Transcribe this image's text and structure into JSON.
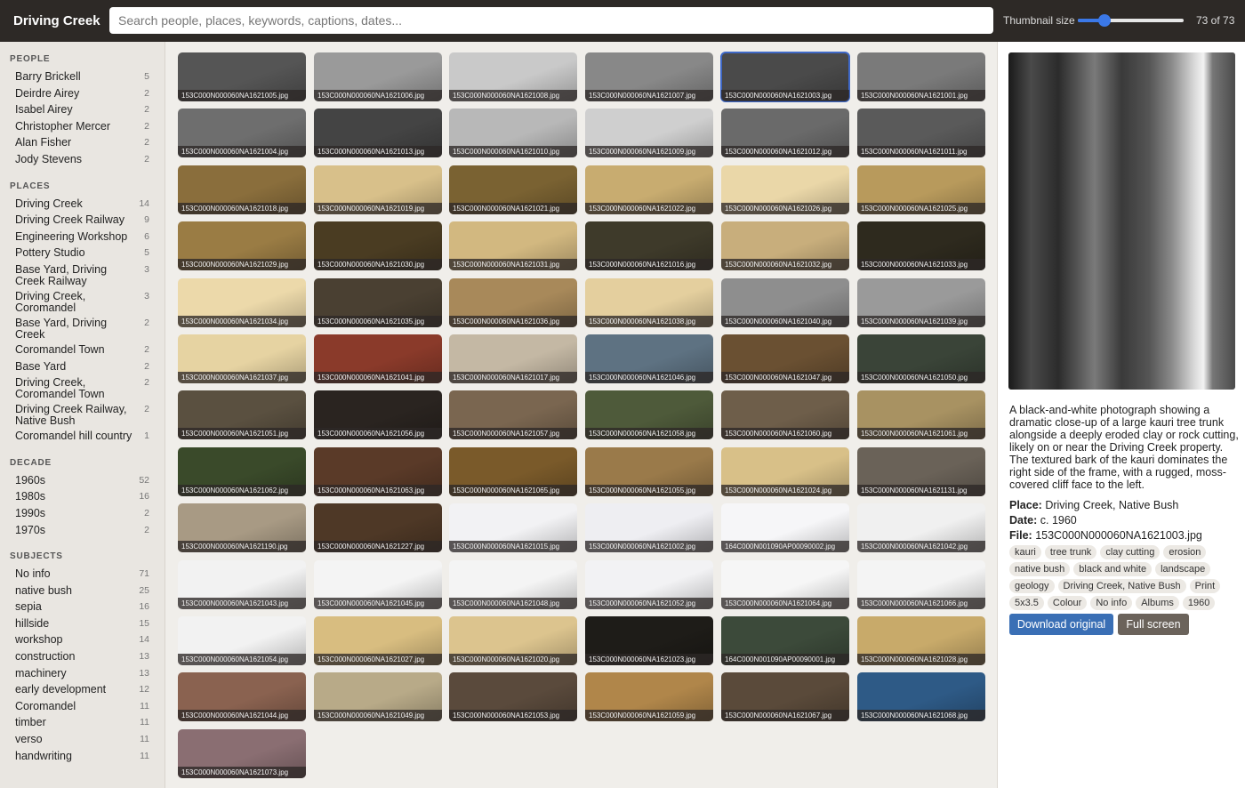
{
  "header": {
    "title": "Driving Creek",
    "search_placeholder": "Search people, places, keywords, captions, dates...",
    "thumbnail_size_label": "Thumbnail size",
    "thumbnail_size_value": 0.25,
    "count": "73 of 73"
  },
  "sidebar": {
    "people": {
      "title": "PEOPLE",
      "items": [
        {
          "label": "Barry Brickell",
          "count": "5"
        },
        {
          "label": "Deirdre Airey",
          "count": "2"
        },
        {
          "label": "Isabel Airey",
          "count": "2"
        },
        {
          "label": "Christopher Mercer",
          "count": "2"
        },
        {
          "label": "Alan Fisher",
          "count": "2"
        },
        {
          "label": "Jody Stevens",
          "count": "2"
        }
      ]
    },
    "places": {
      "title": "PLACES",
      "items": [
        {
          "label": "Driving Creek",
          "count": "14"
        },
        {
          "label": "Driving Creek Railway",
          "count": "9"
        },
        {
          "label": "Engineering Workshop",
          "count": "6"
        },
        {
          "label": "Pottery Studio",
          "count": "5"
        },
        {
          "label": "Base Yard, Driving Creek Railway",
          "count": "3"
        },
        {
          "label": "Driving Creek, Coromandel",
          "count": "3"
        },
        {
          "label": "Base Yard, Driving Creek",
          "count": "2"
        },
        {
          "label": "Coromandel Town",
          "count": "2"
        },
        {
          "label": "Base Yard",
          "count": "2"
        },
        {
          "label": "Driving Creek, Coromandel Town",
          "count": "2"
        },
        {
          "label": "Driving Creek Railway, Native Bush",
          "count": "2"
        },
        {
          "label": "Coromandel hill country",
          "count": "1"
        }
      ]
    },
    "decade": {
      "title": "DECADE",
      "items": [
        {
          "label": "1960s",
          "count": "52"
        },
        {
          "label": "1980s",
          "count": "16"
        },
        {
          "label": "1990s",
          "count": "2"
        },
        {
          "label": "1970s",
          "count": "2"
        }
      ]
    },
    "subjects": {
      "title": "SUBJECTS",
      "items": [
        {
          "label": "No info",
          "count": "71"
        },
        {
          "label": "native bush",
          "count": "25"
        },
        {
          "label": "sepia",
          "count": "16"
        },
        {
          "label": "hillside",
          "count": "15"
        },
        {
          "label": "workshop",
          "count": "14"
        },
        {
          "label": "construction",
          "count": "13"
        },
        {
          "label": "machinery",
          "count": "13"
        },
        {
          "label": "early development",
          "count": "12"
        },
        {
          "label": "Coromandel",
          "count": "11"
        },
        {
          "label": "timber",
          "count": "11"
        },
        {
          "label": "verso",
          "count": "11"
        },
        {
          "label": "handwriting",
          "count": "11"
        }
      ]
    }
  },
  "grid": {
    "items": [
      {
        "file": "153C000N000060NA1621005.jpg",
        "tone": "#555"
      },
      {
        "file": "153C000N000060NA1621006.jpg",
        "tone": "#9a9a9a"
      },
      {
        "file": "153C000N000060NA1621008.jpg",
        "tone": "#c9c9c9"
      },
      {
        "file": "153C000N000060NA1621007.jpg",
        "tone": "#888"
      },
      {
        "file": "153C000N000060NA1621003.jpg",
        "tone": "#4a4a4a",
        "selected": true
      },
      {
        "file": "153C000N000060NA1621001.jpg",
        "tone": "#7a7a7a"
      },
      {
        "file": "153C000N000060NA1621004.jpg",
        "tone": "#6e6e6e"
      },
      {
        "file": "153C000N000060NA1621013.jpg",
        "tone": "#444"
      },
      {
        "file": "153C000N000060NA1621010.jpg",
        "tone": "#b8b8b8"
      },
      {
        "file": "153C000N000060NA1621009.jpg",
        "tone": "#cfcfcf"
      },
      {
        "file": "153C000N000060NA1621012.jpg",
        "tone": "#6a6a6a"
      },
      {
        "file": "153C000N000060NA1621011.jpg",
        "tone": "#5a5a5a"
      },
      {
        "file": "153C000N000060NA1621018.jpg",
        "tone": "#8a6e3c"
      },
      {
        "file": "153C000N000060NA1621019.jpg",
        "tone": "#d8c08a"
      },
      {
        "file": "153C000N000060NA1621021.jpg",
        "tone": "#7a6232"
      },
      {
        "file": "153C000N000060NA1621022.jpg",
        "tone": "#c8ac70"
      },
      {
        "file": "153C000N000060NA1621026.jpg",
        "tone": "#ead7a8"
      },
      {
        "file": "153C000N000060NA1621025.jpg",
        "tone": "#b89a5c"
      },
      {
        "file": "153C000N000060NA1621029.jpg",
        "tone": "#9a7c44"
      },
      {
        "file": "153C000N000060NA1621030.jpg",
        "tone": "#4a3c22"
      },
      {
        "file": "153C000N000060NA1621031.jpg",
        "tone": "#d2b880"
      },
      {
        "file": "153C000N000060NA1621016.jpg",
        "tone": "#3e3a2a"
      },
      {
        "file": "153C000N000060NA1621032.jpg",
        "tone": "#c8ae7c"
      },
      {
        "file": "153C000N000060NA1621033.jpg",
        "tone": "#2e2a1e"
      },
      {
        "file": "153C000N000060NA1621034.jpg",
        "tone": "#ecd9aa"
      },
      {
        "file": "153C000N000060NA1621035.jpg",
        "tone": "#4a4032"
      },
      {
        "file": "153C000N000060NA1621036.jpg",
        "tone": "#a8895a"
      },
      {
        "file": "153C000N000060NA1621038.jpg",
        "tone": "#e4cf9e"
      },
      {
        "file": "153C000N000060NA1621040.jpg",
        "tone": "#8e8e8e"
      },
      {
        "file": "153C000N000060NA1621039.jpg",
        "tone": "#9a9a9a"
      },
      {
        "file": "153C000N000060NA1621037.jpg",
        "tone": "#e6d3a2"
      },
      {
        "file": "153C000N000060NA1621041.jpg",
        "tone": "#8a3a2a"
      },
      {
        "file": "153C000N000060NA1621017.jpg",
        "tone": "#c4b8a4"
      },
      {
        "file": "153C000N000060NA1621046.jpg",
        "tone": "#5e7282"
      },
      {
        "file": "153C000N000060NA1621047.jpg",
        "tone": "#6a5032"
      },
      {
        "file": "153C000N000060NA1621050.jpg",
        "tone": "#3a4438"
      },
      {
        "file": "153C000N000060NA1621051.jpg",
        "tone": "#5a5040"
      },
      {
        "file": "153C000N000060NA1621056.jpg",
        "tone": "#2a2420"
      },
      {
        "file": "153C000N000060NA1621057.jpg",
        "tone": "#7a6650"
      },
      {
        "file": "153C000N000060NA1621058.jpg",
        "tone": "#4e5a3a"
      },
      {
        "file": "153C000N000060NA1621060.jpg",
        "tone": "#6e5e4a"
      },
      {
        "file": "153C000N000060NA1621061.jpg",
        "tone": "#a89262"
      },
      {
        "file": "153C000N000060NA1621062.jpg",
        "tone": "#3a4a2a"
      },
      {
        "file": "153C000N000060NA1621063.jpg",
        "tone": "#5a3a28"
      },
      {
        "file": "153C000N000060NA1621065.jpg",
        "tone": "#7a5a2a"
      },
      {
        "file": "153C000N000060NA1621055.jpg",
        "tone": "#9a7a4a"
      },
      {
        "file": "153C000N000060NA1621024.jpg",
        "tone": "#d8c088"
      },
      {
        "file": "153C000N000060NA1621131.jpg",
        "tone": "#6a6258"
      },
      {
        "file": "153C000N000060NA1621190.jpg",
        "tone": "#a89a84"
      },
      {
        "file": "153C000N000060NA1621227.jpg",
        "tone": "#4e3826"
      },
      {
        "file": "153C000N000060NA1621015.jpg",
        "tone": "#f2f2f4"
      },
      {
        "file": "153C000N000060NA1621002.jpg",
        "tone": "#eeeef2"
      },
      {
        "file": "164C000N001090AP00090002.jpg",
        "tone": "#f6f6f8"
      },
      {
        "file": "153C000N000060NA1621042.jpg",
        "tone": "#f0f0f0"
      },
      {
        "file": "153C000N000060NA1621043.jpg",
        "tone": "#f2f2f2"
      },
      {
        "file": "153C000N000060NA1621045.jpg",
        "tone": "#f4f4f4"
      },
      {
        "file": "153C000N000060NA1621048.jpg",
        "tone": "#f4f4f4"
      },
      {
        "file": "153C000N000060NA1621052.jpg",
        "tone": "#f2f2f4"
      },
      {
        "file": "153C000N000060NA1621064.jpg",
        "tone": "#f6f6f6"
      },
      {
        "file": "153C000N000060NA1621066.jpg",
        "tone": "#f4f4f4"
      },
      {
        "file": "153C000N000060NA1621054.jpg",
        "tone": "#f2f2f2"
      },
      {
        "file": "153C000N000060NA1621027.jpg",
        "tone": "#d8bd80"
      },
      {
        "file": "153C000N000060NA1621020.jpg",
        "tone": "#dcc48e"
      },
      {
        "file": "153C000N000060NA1621023.jpg",
        "tone": "#1e1c18"
      },
      {
        "file": "164C000N001090AP00090001.jpg",
        "tone": "#3c4a3a"
      },
      {
        "file": "153C000N000060NA1621028.jpg",
        "tone": "#c8aa6a"
      },
      {
        "file": "153C000N000060NA1621044.jpg",
        "tone": "#8a6250"
      },
      {
        "file": "153C000N000060NA1621049.jpg",
        "tone": "#b8aa88"
      },
      {
        "file": "153C000N000060NA1621053.jpg",
        "tone": "#5a4a3c"
      },
      {
        "file": "153C000N000060NA1621059.jpg",
        "tone": "#b0864a"
      },
      {
        "file": "153C000N000060NA1621067.jpg",
        "tone": "#5a4a3a"
      },
      {
        "file": "153C000N000060NA1621068.jpg",
        "tone": "#2e5a86"
      },
      {
        "file": "153C000N000060NA1621073.jpg",
        "tone": "#8a6e72"
      }
    ]
  },
  "detail": {
    "description": "A black-and-white photograph showing a dramatic close-up of a large kauri tree trunk alongside a deeply eroded clay or rock cutting, likely on or near the Driving Creek property. The textured bark of the kauri dominates the right side of the frame, with a rugged, moss-covered cliff face to the left.",
    "place_label": "Place:",
    "place": "Driving Creek, Native Bush",
    "date_label": "Date:",
    "date": "c. 1960",
    "file_label": "File:",
    "file": "153C000N000060NA1621003.jpg",
    "tags": [
      "kauri",
      "tree trunk",
      "clay cutting",
      "erosion",
      "native bush",
      "black and white",
      "landscape",
      "geology",
      "Driving Creek, Native Bush",
      "Print",
      "5x3.5",
      "Colour",
      "No info",
      "Albums",
      "1960"
    ],
    "download_label": "Download original",
    "fullscreen_label": "Full screen"
  }
}
